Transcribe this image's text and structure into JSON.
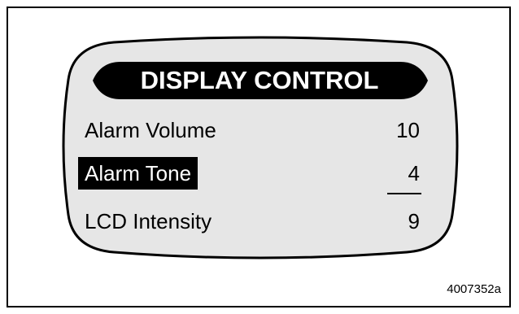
{
  "display": {
    "title": "DISPLAY CONTROL",
    "rows": [
      {
        "label": "Alarm Volume",
        "value": "10",
        "selected": false
      },
      {
        "label": "Alarm Tone",
        "value": "4",
        "selected": true
      },
      {
        "label": "LCD Intensity",
        "value": "9",
        "selected": false
      }
    ]
  },
  "figure_id": "4007352a",
  "colors": {
    "screen_fill": "#e6e6e6",
    "outline": "#000000",
    "highlight_bg": "#000000",
    "highlight_text": "#ffffff"
  }
}
